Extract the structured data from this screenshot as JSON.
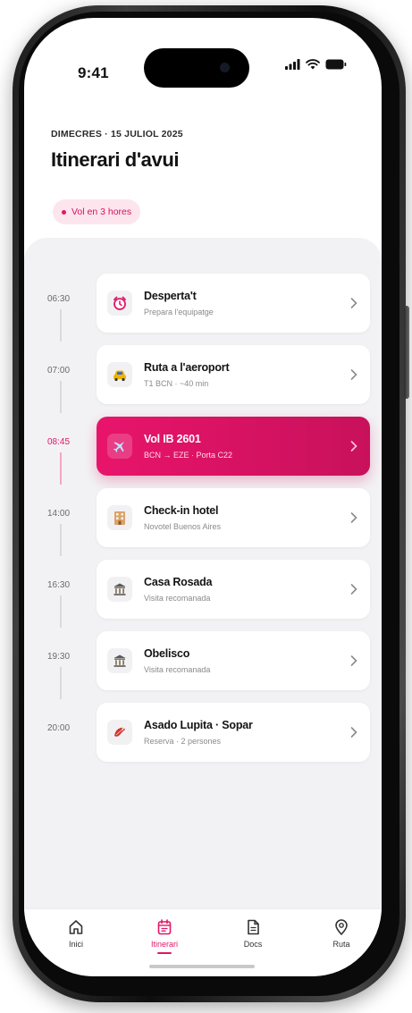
{
  "status_bar": {
    "time": "9:41",
    "icons": [
      "signal-icon",
      "wifi-icon",
      "battery-icon"
    ]
  },
  "header": {
    "date": "DIMECRES · 15 JULIOL 2025",
    "title": "Itinerari d'avui",
    "chip": "Vol en 3 hores"
  },
  "timeline": [
    {
      "time": "06:30",
      "title": "Desperta't",
      "subtitle": "Prepara l'equipatge",
      "icon": "alarm-clock-icon",
      "active": false
    },
    {
      "time": "07:00",
      "title": "Ruta a l'aeroport",
      "subtitle": "T1 BCN · ~40 min",
      "icon": "taxi-icon",
      "active": false
    },
    {
      "time": "08:45",
      "title": "Vol IB 2601",
      "subtitle": "BCN → EZE · Porta C22",
      "icon": "airplane-icon",
      "active": true
    },
    {
      "time": "14:00",
      "title": "Check-in hotel",
      "subtitle": "Novotel Buenos Aires",
      "icon": "hotel-icon",
      "active": false
    },
    {
      "time": "16:30",
      "title": "Casa Rosada",
      "subtitle": "Visita recomanada",
      "icon": "landmark-icon",
      "active": false
    },
    {
      "time": "19:30",
      "title": "Obelisco",
      "subtitle": "Visita recomanada",
      "icon": "landmark-icon",
      "active": false
    },
    {
      "time": "20:00",
      "title": "Asado Lupita · Sopar",
      "subtitle": "Reserva · 2 persones",
      "icon": "food-icon",
      "active": false
    }
  ],
  "tabs": [
    {
      "label": "Inici",
      "icon": "home-icon",
      "active": false
    },
    {
      "label": "Itinerari",
      "icon": "calendar-icon",
      "active": true
    },
    {
      "label": "Docs",
      "icon": "document-icon",
      "active": false
    },
    {
      "label": "Ruta",
      "icon": "map-pin-icon",
      "active": false
    }
  ],
  "colors": {
    "accent": "#e0176a",
    "chip_background": "#fde5ee",
    "panel_background": "#f2f2f4"
  }
}
